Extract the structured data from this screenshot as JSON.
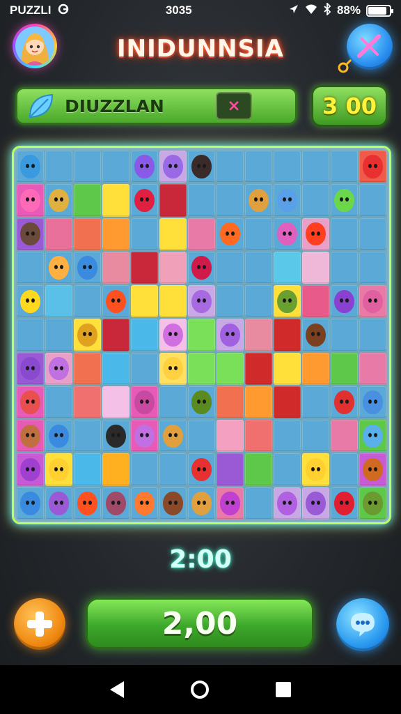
{
  "status_bar": {
    "app_label": "PUZZLI",
    "time": "3035",
    "battery": "88%",
    "battery_level": 0.88
  },
  "header": {
    "title": "INIDUNNSIA"
  },
  "progress": {
    "label": "DIUZZLAN",
    "tag": "×"
  },
  "score": "3 00",
  "timer": "2:00",
  "main_button": "2,00",
  "colors": {
    "accent_green": "#4aa82a",
    "timer_glow": "#4affd8",
    "title_glow": "#ff3a1a"
  },
  "board": {
    "rows": 11,
    "cols": 13,
    "cells": [
      [
        "#5aa9d6",
        "#5aa9d6",
        "#5aa9d6",
        "#5aa9d6",
        "#5aa9d6",
        "#c9a8e6",
        "#5aa9d6",
        "#5aa9d6",
        "#5aa9d6",
        "#5aa9d6",
        "#5aa9d6",
        "#5aa9d6",
        "#f05a48"
      ],
      [
        "#e85ab8",
        "#5aa9d6",
        "#5ec84a",
        "#ffe03a",
        "#5aa9d6",
        "#c8283a",
        "#5aa9d6",
        "#5aa9d6",
        "#5aa9d6",
        "#5aa9d6",
        "#5aa9d6",
        "#5aa9d6",
        "#5aa9d6"
      ],
      [
        "#9a5ad6",
        "#e8709a",
        "#f07050",
        "#ff9a30",
        "#5aa9d6",
        "#ffe03a",
        "#e87aa8",
        "#5aa9d6",
        "#5aa9d6",
        "#5aa9d6",
        "#e8a0c8",
        "#5aa9d6",
        "#5aa9d6"
      ],
      [
        "#5aa9d6",
        "#5aa9d6",
        "#5aa9d6",
        "#e88aa0",
        "#c8283a",
        "#f0a0b8",
        "#5aa9d6",
        "#5aa9d6",
        "#5aa9d6",
        "#5ac8e8",
        "#f0b8d8",
        "#5aa9d6",
        "#5aa9d6"
      ],
      [
        "#5aa9d6",
        "#5ac0e8",
        "#5aa9d6",
        "#5aa9d6",
        "#ffe03a",
        "#ffe03a",
        "#c9a8e6",
        "#5aa9d6",
        "#5aa9d6",
        "#ffe03a",
        "#e85a8a",
        "#5aa9d6",
        "#e87aa8"
      ],
      [
        "#5aa9d6",
        "#5aa9d6",
        "#ffe03a",
        "#c8283a",
        "#4ab8e8",
        "#f4c0e8",
        "#7ae05a",
        "#c9a8e6",
        "#e88aa0",
        "#d02a2a",
        "#5aa9d6",
        "#5aa9d6",
        "#5aa9d6"
      ],
      [
        "#9a5ad6",
        "#e8a0c8",
        "#f07050",
        "#4ab8e8",
        "#5aa9d6",
        "#ffe060",
        "#7ae05a",
        "#7ae05a",
        "#d02a2a",
        "#ffe03a",
        "#ff9a30",
        "#5ec84a",
        "#e87aa8"
      ],
      [
        "#e85ab8",
        "#5aa9d6",
        "#f07070",
        "#f4c0e8",
        "#e85ab8",
        "#5aa9d6",
        "#5aa9d6",
        "#f07050",
        "#ff9a30",
        "#d02a2a",
        "#5aa9d6",
        "#5aa9d6",
        "#5aa9d6"
      ],
      [
        "#e85ab8",
        "#5aa9d6",
        "#5aa9d6",
        "#5aa9d6",
        "#e85ab8",
        "#5aa9d6",
        "#5aa9d6",
        "#f4a0c0",
        "#f07070",
        "#5aa9d6",
        "#5aa9d6",
        "#e87aa8",
        "#5ec84a"
      ],
      [
        "#c85ad6",
        "#ffe03a",
        "#4ab8e8",
        "#ffb020",
        "#5aa9d6",
        "#5aa9d6",
        "#5aa9d6",
        "#9a5ad6",
        "#5ec84a",
        "#5aa9d6",
        "#ffe03a",
        "#5aa9d6",
        "#c85ad6"
      ],
      [
        "#5aa9d6",
        "#5aa9d6",
        "#5aa9d6",
        "#5aa9d6",
        "#5aa9d6",
        "#5aa9d6",
        "#5aa9d6",
        "#e87aa8",
        "#5aa9d6",
        "#c9a8e6",
        "#c9a8e6",
        "#5aa9d6",
        "#5ec84a"
      ]
    ],
    "characters": [
      [
        0,
        0,
        "#3a9ae0"
      ],
      [
        0,
        4,
        "#8a5ae6"
      ],
      [
        0,
        5,
        "#9a6ae6"
      ],
      [
        0,
        6,
        "#3a2a2a"
      ],
      [
        0,
        12,
        "#e83030"
      ],
      [
        1,
        0,
        "#ff6ab8"
      ],
      [
        1,
        1,
        "#e0b040"
      ],
      [
        1,
        4,
        "#e02040"
      ],
      [
        1,
        8,
        "#e0a040"
      ],
      [
        1,
        9,
        "#5aa0e8"
      ],
      [
        1,
        11,
        "#6ad84a"
      ],
      [
        2,
        0,
        "#6a4a3a"
      ],
      [
        2,
        7,
        "#ff6a20"
      ],
      [
        2,
        9,
        "#e060c0"
      ],
      [
        2,
        10,
        "#ff4020"
      ],
      [
        3,
        1,
        "#ffb040"
      ],
      [
        3,
        2,
        "#3a8ae0"
      ],
      [
        3,
        6,
        "#d01a4a"
      ],
      [
        4,
        0,
        "#ffd820"
      ],
      [
        4,
        3,
        "#ff5020"
      ],
      [
        4,
        6,
        "#a86ae0"
      ],
      [
        4,
        9,
        "#6aa030"
      ],
      [
        4,
        11,
        "#8a40d0"
      ],
      [
        4,
        12,
        "#e060a0"
      ],
      [
        5,
        2,
        "#e0a020"
      ],
      [
        5,
        5,
        "#d070e0"
      ],
      [
        5,
        7,
        "#a060e0"
      ],
      [
        5,
        10,
        "#7a4020"
      ],
      [
        6,
        0,
        "#8a4ad0"
      ],
      [
        6,
        1,
        "#c070e0"
      ],
      [
        6,
        5,
        "#ffd040"
      ],
      [
        7,
        0,
        "#e85050"
      ],
      [
        7,
        4,
        "#c84aa0"
      ],
      [
        7,
        6,
        "#5a8a20"
      ],
      [
        7,
        11,
        "#e03030"
      ],
      [
        7,
        12,
        "#4a90e0"
      ],
      [
        8,
        0,
        "#c07040"
      ],
      [
        8,
        1,
        "#3a8ae0"
      ],
      [
        8,
        3,
        "#2a2a2a"
      ],
      [
        8,
        4,
        "#c070e0"
      ],
      [
        8,
        5,
        "#e0a040"
      ],
      [
        8,
        12,
        "#5ab0e8"
      ],
      [
        9,
        0,
        "#a040d0"
      ],
      [
        9,
        1,
        "#ffd030"
      ],
      [
        9,
        6,
        "#e83030"
      ],
      [
        9,
        10,
        "#ffd030"
      ],
      [
        9,
        12,
        "#d06a20"
      ],
      [
        10,
        0,
        "#3a8ae0"
      ],
      [
        10,
        1,
        "#9a5ad6"
      ],
      [
        10,
        2,
        "#ff5020"
      ],
      [
        10,
        3,
        "#a04a6a"
      ],
      [
        10,
        4,
        "#ff7a30"
      ],
      [
        10,
        5,
        "#8a4a2a"
      ],
      [
        10,
        6,
        "#e0a040"
      ],
      [
        10,
        7,
        "#c040d0"
      ],
      [
        10,
        9,
        "#b060e0"
      ],
      [
        10,
        10,
        "#9a5ad6"
      ],
      [
        10,
        11,
        "#e02030"
      ],
      [
        10,
        12,
        "#6a9a30"
      ]
    ]
  }
}
